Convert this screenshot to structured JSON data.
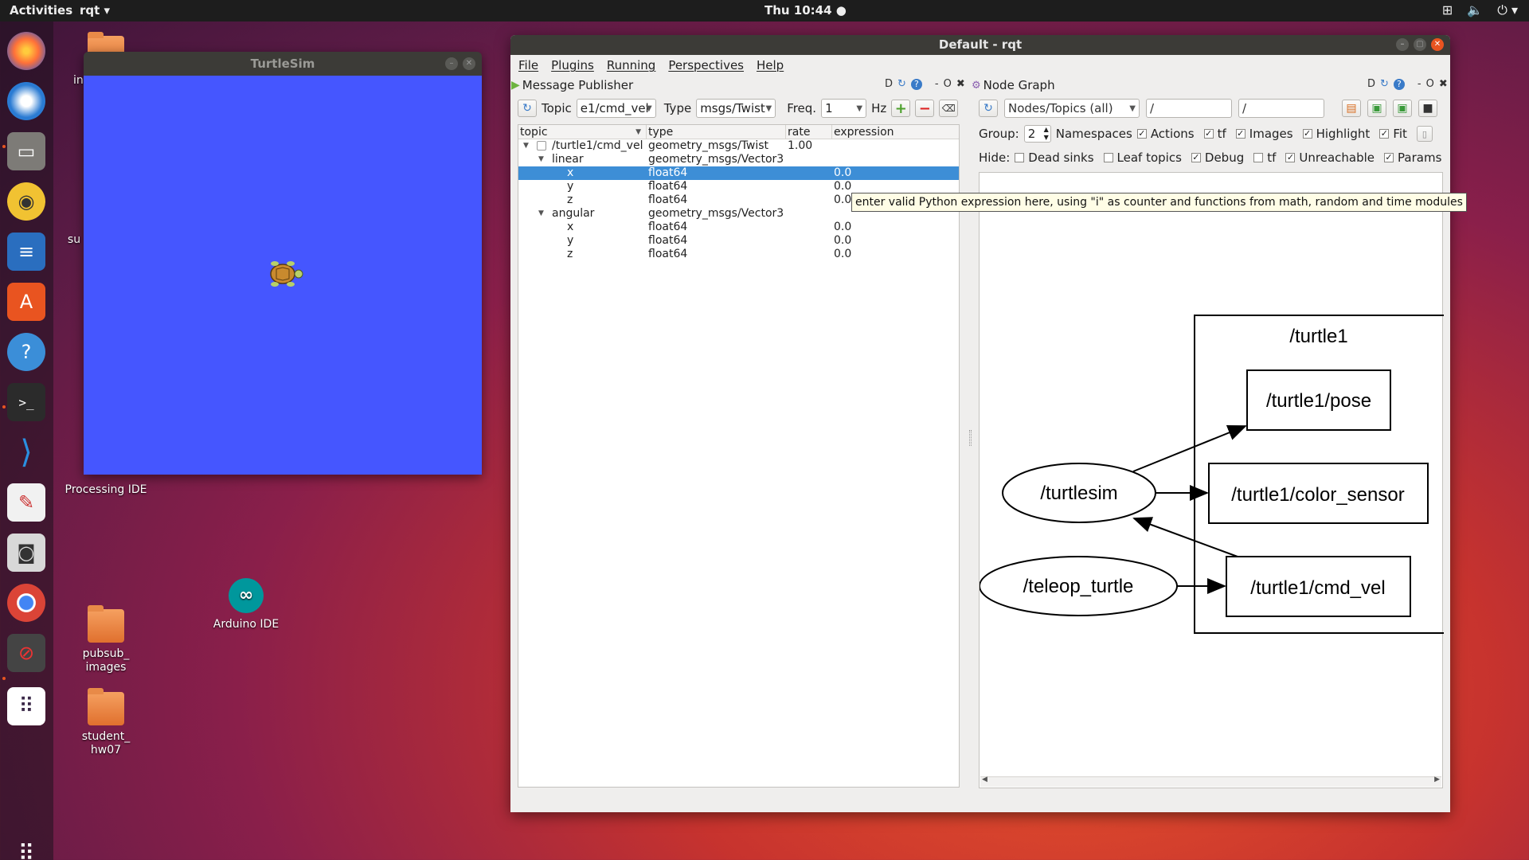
{
  "topbar": {
    "activities": "Activities",
    "app_menu": "rqt ▾",
    "clock": "Thu 10:44 ●",
    "tray_icons": [
      "network-icon",
      "volume-icon",
      "power-icon"
    ]
  },
  "dock": {
    "items": [
      "firefox-icon",
      "thunderbird-icon",
      "files-icon",
      "rhythmbox-icon",
      "writer-icon",
      "software-icon",
      "help-icon",
      "terminal-icon",
      "vscode-icon",
      "app-icon",
      "camera-icon",
      "chrome-icon",
      "blocked-icon",
      "show-apps-icon"
    ]
  },
  "desktop": {
    "processing_label": "Processing IDE",
    "arduino_label": "Arduino IDE",
    "pubsub_label": "pubsub_ images",
    "student_label": "student_ hw07",
    "partial_in": "in",
    "partial_su": "su"
  },
  "turtlesim": {
    "title": "TurtleSim"
  },
  "rqt": {
    "title": "Default - rqt",
    "menu": [
      "File",
      "Plugins",
      "Running",
      "Perspectives",
      "Help"
    ],
    "publisher": {
      "title": "Message Publisher",
      "ctrls": "D  - O",
      "topic_label": "Topic",
      "topic_value": "e1/cmd_vel",
      "type_label": "Type",
      "type_value": "msgs/Twist",
      "freq_label": "Freq.",
      "freq_value": "1",
      "hz_label": "Hz",
      "columns": [
        "topic",
        "type",
        "rate",
        "expression"
      ],
      "rows": [
        {
          "topic": "/turtle1/cmd_vel",
          "type": "geometry_msgs/Twist",
          "rate": "1.00",
          "expr": ""
        },
        {
          "topic": "linear",
          "type": "geometry_msgs/Vector3",
          "rate": "",
          "expr": ""
        },
        {
          "topic": "x",
          "type": "float64",
          "rate": "",
          "expr": "0.0"
        },
        {
          "topic": "y",
          "type": "float64",
          "rate": "",
          "expr": "0.0"
        },
        {
          "topic": "z",
          "type": "float64",
          "rate": "",
          "expr": "0.0"
        },
        {
          "topic": "angular",
          "type": "geometry_msgs/Vector3",
          "rate": "",
          "expr": ""
        },
        {
          "topic": "x",
          "type": "float64",
          "rate": "",
          "expr": "0.0"
        },
        {
          "topic": "y",
          "type": "float64",
          "rate": "",
          "expr": "0.0"
        },
        {
          "topic": "z",
          "type": "float64",
          "rate": "",
          "expr": "0.0"
        }
      ],
      "tooltip": "enter valid Python expression here, using \"i\" as counter and functions from math, random and time modules"
    },
    "graph": {
      "title": "Node Graph",
      "ctrls": "D  - O",
      "mode": "Nodes/Topics (all)",
      "filter1": "/",
      "filter2": "/",
      "group_label": "Group:",
      "group_value": "2",
      "namespaces": "Namespaces",
      "opts_row1": [
        {
          "label": "Actions",
          "checked": true
        },
        {
          "label": "tf",
          "checked": true
        },
        {
          "label": "Images",
          "checked": true
        },
        {
          "label": "Highlight",
          "checked": true
        },
        {
          "label": "Fit",
          "checked": true
        }
      ],
      "hide_label": "Hide:",
      "opts_row2": [
        {
          "label": "Dead sinks",
          "checked": false
        },
        {
          "label": "Leaf topics",
          "checked": false
        },
        {
          "label": "Debug",
          "checked": true
        },
        {
          "label": "tf",
          "checked": false
        },
        {
          "label": "Unreachable",
          "checked": true
        },
        {
          "label": "Params",
          "checked": true
        }
      ],
      "cluster": "/turtle1",
      "nodes": {
        "turtlesim": "/turtlesim",
        "teleop": "/teleop_turtle",
        "pose": "/turtle1/pose",
        "color_sensor": "/turtle1/color_sensor",
        "cmd_vel": "/turtle1/cmd_vel"
      }
    }
  }
}
